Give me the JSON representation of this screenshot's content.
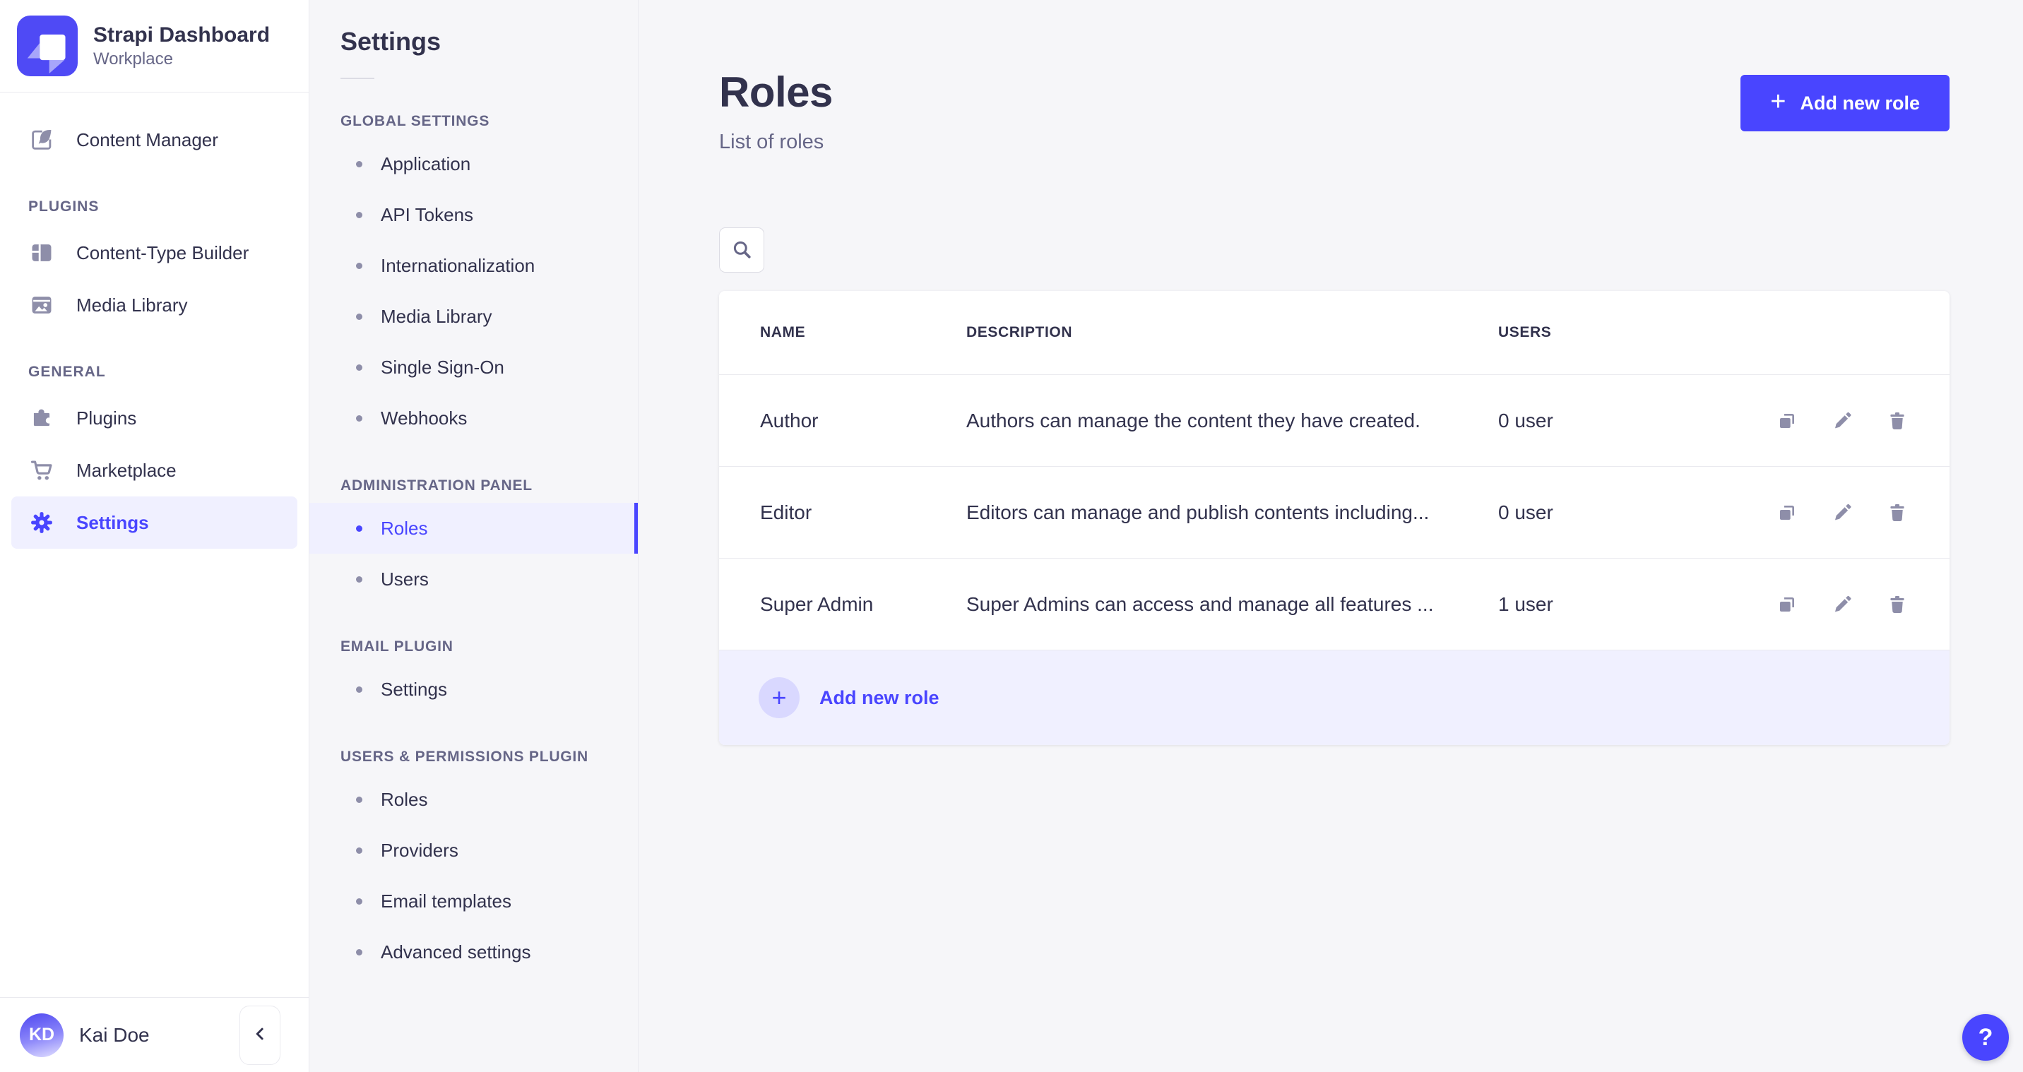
{
  "app": {
    "name": "Strapi Dashboard",
    "workspace": "Workplace"
  },
  "sidebar": {
    "content_manager": "Content Manager",
    "sections": [
      {
        "title": "PLUGINS",
        "items": [
          "Content-Type Builder",
          "Media Library"
        ]
      },
      {
        "title": "GENERAL",
        "items": [
          "Plugins",
          "Marketplace",
          "Settings"
        ]
      }
    ],
    "active_item": "Settings",
    "user": {
      "initials": "KD",
      "name": "Kai Doe"
    }
  },
  "subnav": {
    "title": "Settings",
    "sections": [
      {
        "title": "GLOBAL SETTINGS",
        "items": [
          "Application",
          "API Tokens",
          "Internationalization",
          "Media Library",
          "Single Sign-On",
          "Webhooks"
        ]
      },
      {
        "title": "ADMINISTRATION PANEL",
        "items": [
          "Roles",
          "Users"
        ]
      },
      {
        "title": "EMAIL PLUGIN",
        "items": [
          "Settings"
        ]
      },
      {
        "title": "USERS & PERMISSIONS PLUGIN",
        "items": [
          "Roles",
          "Providers",
          "Email templates",
          "Advanced settings"
        ]
      }
    ],
    "active_item": "Roles"
  },
  "main": {
    "title": "Roles",
    "subtitle": "List of roles",
    "add_button_label": "Add new role",
    "table": {
      "headers": [
        "NAME",
        "DESCRIPTION",
        "USERS"
      ],
      "rows": [
        {
          "name": "Author",
          "description": "Authors can manage the content they have created.",
          "users": "0 user"
        },
        {
          "name": "Editor",
          "description": "Editors can manage and publish contents including...",
          "users": "0 user"
        },
        {
          "name": "Super Admin",
          "description": "Super Admins can access and manage all features ...",
          "users": "1 user"
        }
      ],
      "footer_add_label": "Add new role"
    },
    "help_label": "?"
  },
  "icons": {
    "logo": "strapi-logo",
    "row_actions": [
      "duplicate-icon",
      "edit-icon",
      "delete-icon"
    ]
  },
  "colors": {
    "primary": "#4945ff",
    "primary_light_bg": "#f0f0ff",
    "text_dark": "#32324d",
    "text_muted": "#666687",
    "icon_gray": "#8e8ea9",
    "border": "#eaeaef",
    "content_bg": "#f6f6f9",
    "card_bg": "#ffffff"
  }
}
